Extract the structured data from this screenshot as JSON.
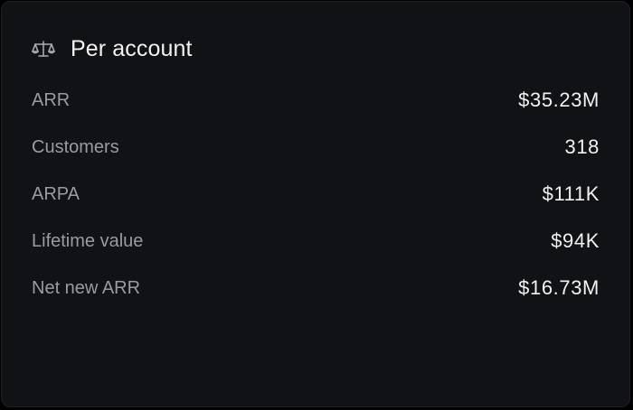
{
  "card": {
    "title": "Per account",
    "icon": "scale-icon",
    "metrics": [
      {
        "label": "ARR",
        "value": "$35.23M"
      },
      {
        "label": "Customers",
        "value": "318"
      },
      {
        "label": "ARPA",
        "value": "$111K"
      },
      {
        "label": "Lifetime value",
        "value": "$94K"
      },
      {
        "label": "Net new ARR",
        "value": "$16.73M"
      }
    ]
  },
  "colors": {
    "background": "#111215",
    "label": "#9a9ba0",
    "value": "#f1f1f2"
  }
}
